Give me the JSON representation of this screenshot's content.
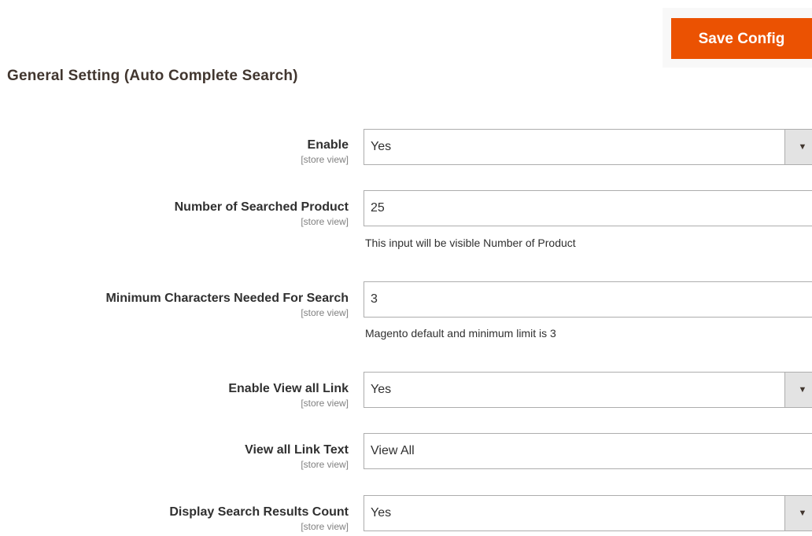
{
  "toolbar": {
    "save_label": "Save Config"
  },
  "section": {
    "title": "General Setting (Auto Complete Search)"
  },
  "fields": [
    {
      "label": "Enable",
      "scope": "[store view]",
      "type": "select",
      "value": "Yes"
    },
    {
      "label": "Number of Searched Product",
      "scope": "[store view]",
      "type": "text",
      "value": "25",
      "note": "This input will be visible Number of Product"
    },
    {
      "label": "Minimum Characters Needed For Search",
      "scope": "[store view]",
      "type": "text",
      "value": "3",
      "note": "Magento default and minimum limit is 3"
    },
    {
      "label": "Enable View all Link",
      "scope": "[store view]",
      "type": "select",
      "value": "Yes"
    },
    {
      "label": "View all Link Text",
      "scope": "[store view]",
      "type": "text",
      "value": "View All"
    },
    {
      "label": "Display Search Results Count",
      "scope": "[store view]",
      "type": "select",
      "value": "Yes"
    }
  ],
  "icons": {
    "select_arrow": "▼"
  },
  "colors": {
    "accent": "#eb5202",
    "title": "#41362f",
    "border": "#adadad"
  }
}
